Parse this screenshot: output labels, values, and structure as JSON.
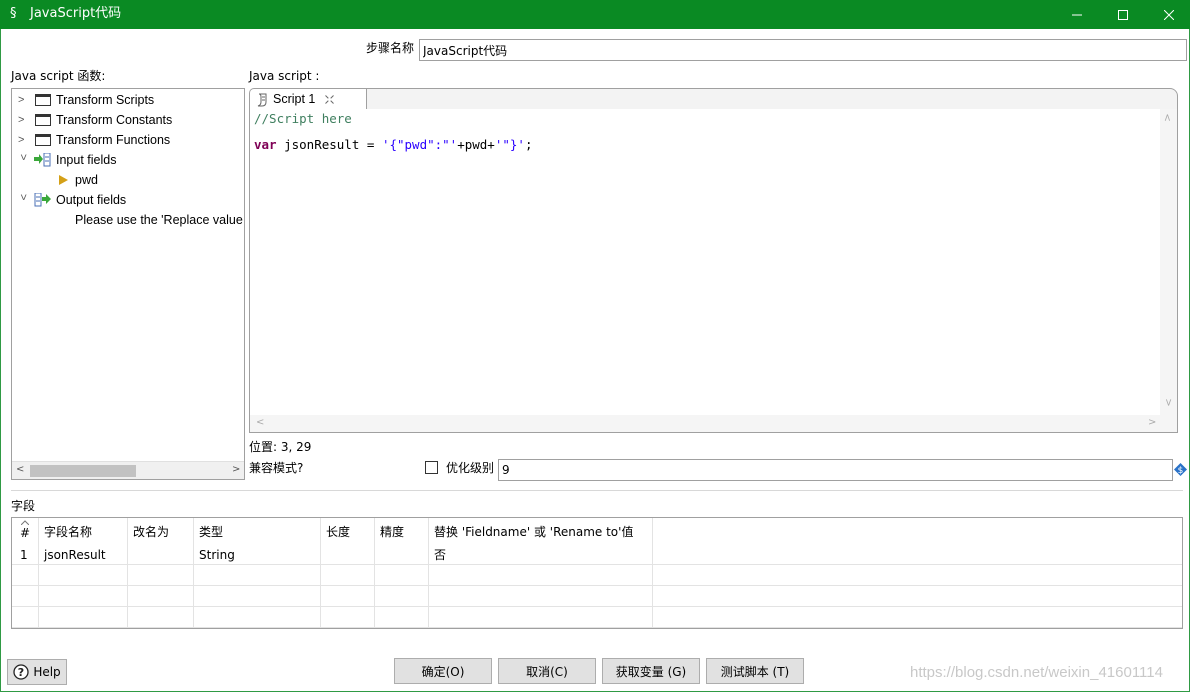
{
  "window": {
    "title": "JavaScript代码",
    "icon": "javascript-icon"
  },
  "step_name": {
    "label": "步骤名称",
    "value": "JavaScript代码"
  },
  "functions_panel": {
    "label": "Java script 函数:",
    "tree": [
      {
        "label": "Transform Scripts",
        "icon": "folder-icon"
      },
      {
        "label": "Transform Constants",
        "icon": "folder-icon"
      },
      {
        "label": "Transform Functions",
        "icon": "folder-icon"
      },
      {
        "label": "Input fields",
        "icon": "input-fields-icon"
      },
      {
        "label": "pwd",
        "icon": "field-arrow-icon"
      },
      {
        "label": "Output fields",
        "icon": "output-fields-icon"
      },
      {
        "label": "Please use the 'Replace value"
      }
    ]
  },
  "script_panel": {
    "label": "Java script :",
    "tab_label": "Script 1",
    "code_comment": "//Script here",
    "code_keyword": "var",
    "code_mid": " jsonResult = ",
    "code_str1": "'{\"pwd\":\"'",
    "code_plus": "+pwd+",
    "code_str2": "'\"}'",
    "code_end": ";"
  },
  "status": {
    "position": "位置: 3, 29",
    "compat_label": "兼容模式?",
    "optimize_label": "优化级别",
    "optimize_value": "9"
  },
  "fields": {
    "section_label": "字段",
    "columns": [
      "#",
      "字段名称",
      "改名为",
      "类型",
      "长度",
      "精度",
      "替换 'Fieldname' 或 'Rename to'值"
    ],
    "rows": [
      {
        "num": "1",
        "name": "jsonResult",
        "rename": "",
        "type": "String",
        "length": "",
        "precision": "",
        "replace": "否"
      }
    ]
  },
  "buttons": {
    "help": "Help",
    "ok": "确定(O)",
    "cancel": "取消(C)",
    "get_vars": "获取变量 (G)",
    "test": "测试脚本 (T)"
  },
  "watermark": "https://blog.csdn.net/weixin_41601114",
  "colors": {
    "titlebar": "#0a8a23",
    "code_comment": "#3f7f5f",
    "code_keyword": "#7f0055",
    "code_string": "#2a00ff"
  }
}
